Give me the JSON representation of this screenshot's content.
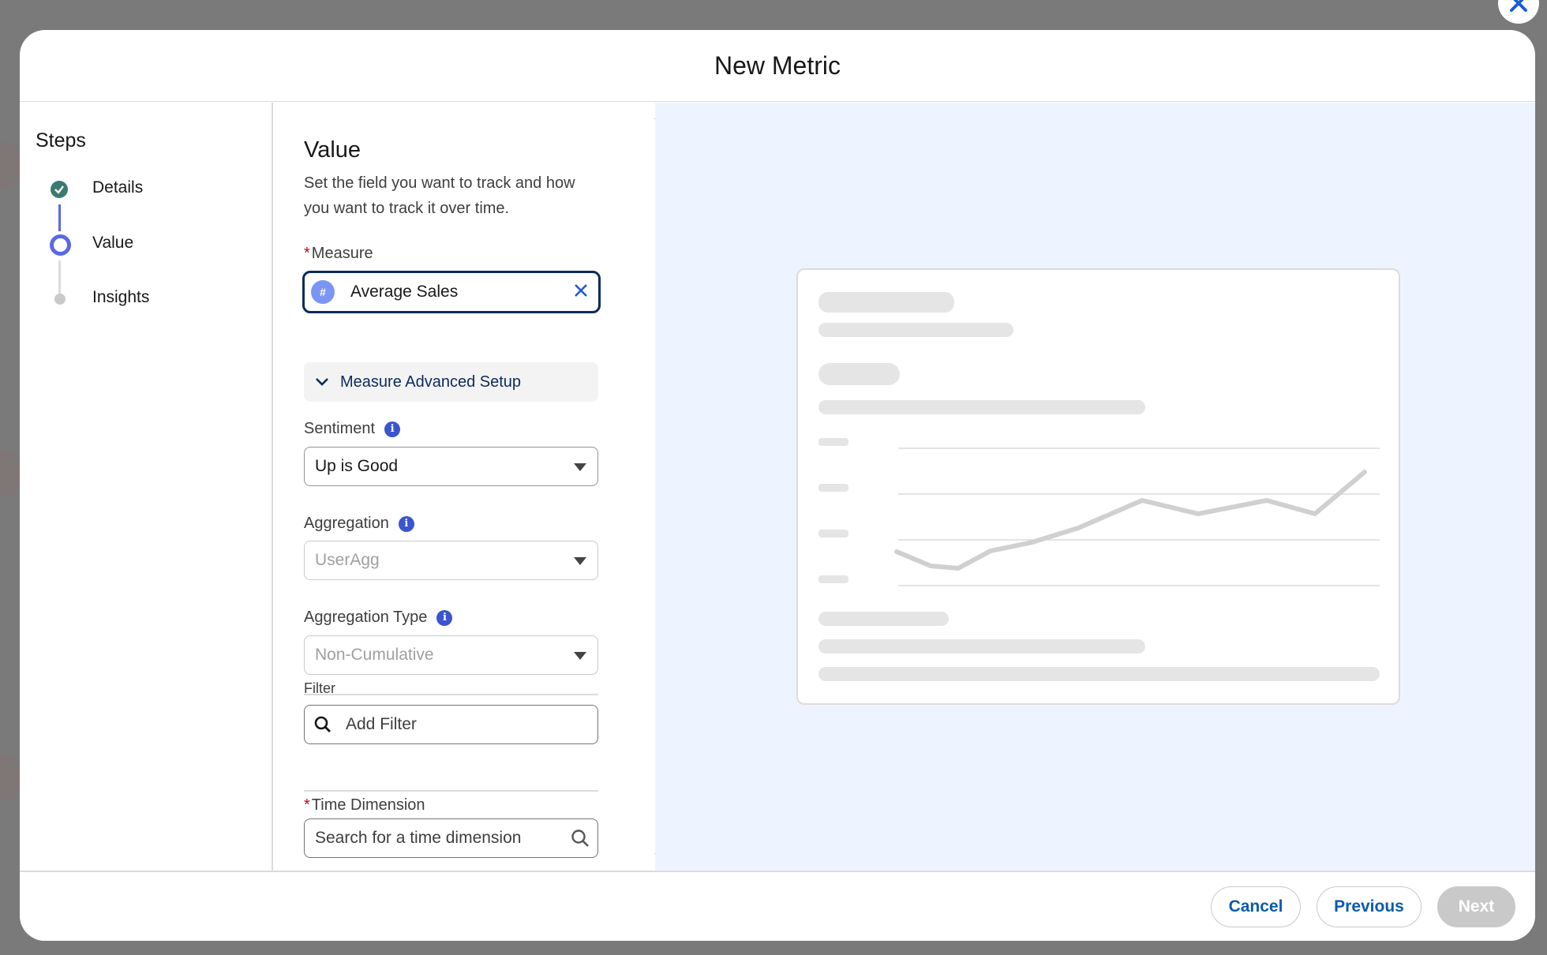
{
  "modal": {
    "title": "New Metric"
  },
  "steps": {
    "title": "Steps",
    "items": [
      {
        "label": "Details",
        "state": "complete"
      },
      {
        "label": "Value",
        "state": "current"
      },
      {
        "label": "Insights",
        "state": "upcoming"
      }
    ]
  },
  "form": {
    "section_title": "Value",
    "section_desc": "Set the field you want to track and how you want to track it over time.",
    "measure": {
      "label": "Measure",
      "required": "*",
      "value": "Average Sales",
      "icon": "#"
    },
    "advanced_setup_label": "Measure Advanced Setup",
    "sentiment": {
      "label": "Sentiment",
      "value": "Up is Good"
    },
    "aggregation": {
      "label": "Aggregation",
      "value": "UserAgg"
    },
    "aggregation_type": {
      "label": "Aggregation Type",
      "value": "Non-Cumulative"
    },
    "filter": {
      "label": "Filter",
      "placeholder": "Add Filter"
    },
    "time_dimension": {
      "label": "Time Dimension",
      "required": "*",
      "placeholder": "Search for a time dimension"
    }
  },
  "footer": {
    "cancel": "Cancel",
    "previous": "Previous",
    "next": "Next"
  },
  "colors": {
    "accent": "#5a68e6",
    "complete": "#3b7a6f",
    "link": "#0b5cab",
    "preview_bg": "#eef4ff"
  }
}
